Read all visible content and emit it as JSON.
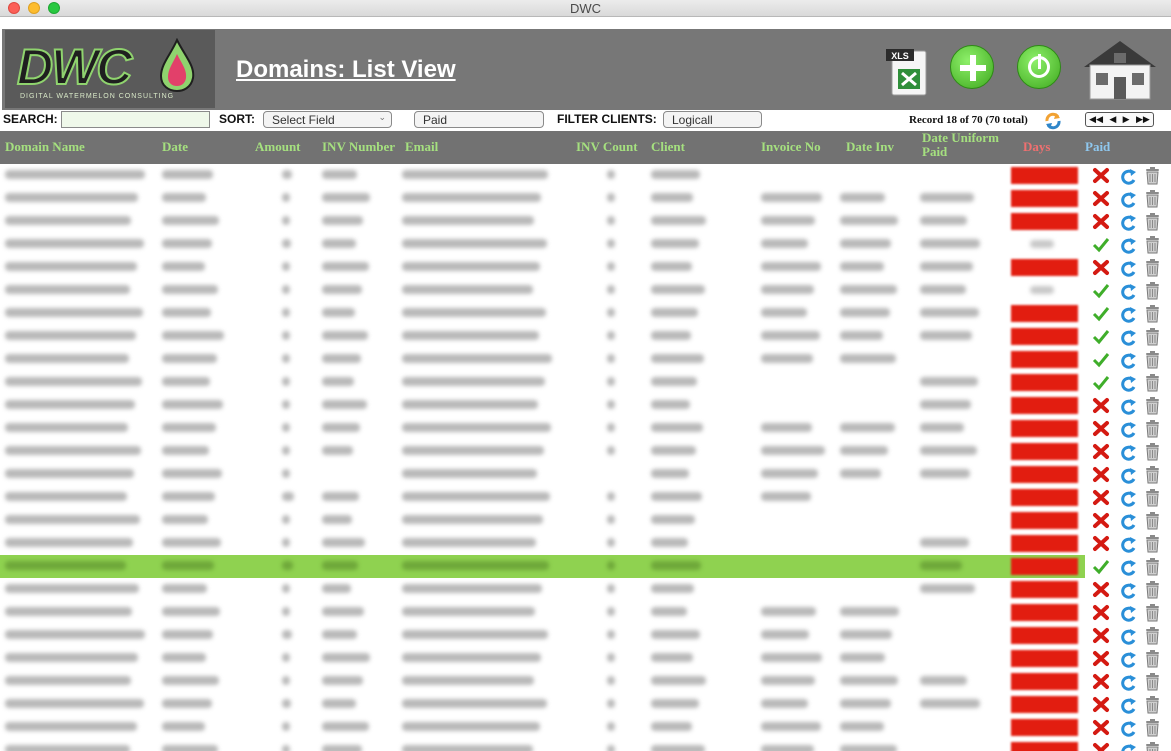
{
  "window": {
    "title": "DWC"
  },
  "header": {
    "logo_text": "DWC",
    "logo_subtext": "DIGITAL WATERMELON CONSULTING",
    "page_title": "Domains: List View",
    "xls_label": "XLS"
  },
  "toolbar": {
    "search_label": "SEARCH:",
    "search_value": "",
    "sort_label": "SORT:",
    "sort_value": "Select Field",
    "paid_filter_value": "Paid",
    "filter_label": "FILTER CLIENTS:",
    "filter_value": "Logicall",
    "record_text": "Record 18 of 70 (70 total)"
  },
  "columns": {
    "domain_name": "Domain Name",
    "date": "Date",
    "amount": "Amount",
    "inv_number": "INV Number",
    "email": "Email",
    "inv_count": "INV Count",
    "client": "Client",
    "invoice_no": "Invoice No",
    "date_inv": "Date Inv",
    "date_uniform_paid_1": "Date Uniform",
    "date_uniform_paid_2": "Paid",
    "days": "Days",
    "paid": "Paid"
  },
  "colors": {
    "header_bg": "#777777",
    "column_text": "#a5e07f",
    "days_red": "#e21d10",
    "selected_row": "#8fd250",
    "paid_blue": "#8fc8ef"
  },
  "rows": [
    {
      "paid": false,
      "days": "red",
      "cols": [
        1,
        1,
        1,
        1,
        1,
        1,
        1,
        0,
        0,
        0
      ]
    },
    {
      "paid": false,
      "days": "red",
      "cols": [
        1,
        1,
        1,
        1,
        1,
        1,
        1,
        1,
        1,
        1
      ]
    },
    {
      "paid": false,
      "days": "red",
      "cols": [
        1,
        1,
        1,
        1,
        1,
        1,
        1,
        1,
        1,
        1
      ]
    },
    {
      "paid": true,
      "days": "blank",
      "cols": [
        1,
        1,
        1,
        1,
        1,
        1,
        1,
        1,
        1,
        1
      ]
    },
    {
      "paid": false,
      "days": "red",
      "cols": [
        1,
        1,
        1,
        1,
        1,
        1,
        1,
        1,
        1,
        1
      ]
    },
    {
      "paid": true,
      "days": "blank",
      "cols": [
        1,
        1,
        1,
        1,
        1,
        1,
        1,
        1,
        1,
        1
      ]
    },
    {
      "paid": true,
      "days": "red",
      "cols": [
        1,
        1,
        1,
        1,
        1,
        1,
        1,
        1,
        1,
        1
      ]
    },
    {
      "paid": true,
      "days": "red",
      "cols": [
        1,
        1,
        1,
        1,
        1,
        1,
        1,
        1,
        1,
        1
      ]
    },
    {
      "paid": true,
      "days": "red",
      "cols": [
        1,
        1,
        1,
        1,
        1,
        1,
        1,
        1,
        1,
        0
      ]
    },
    {
      "paid": true,
      "days": "red",
      "cols": [
        1,
        1,
        1,
        1,
        1,
        1,
        1,
        0,
        0,
        1
      ]
    },
    {
      "paid": false,
      "days": "red",
      "cols": [
        1,
        1,
        1,
        1,
        1,
        1,
        1,
        0,
        0,
        1
      ]
    },
    {
      "paid": false,
      "days": "red",
      "cols": [
        1,
        1,
        1,
        1,
        1,
        1,
        1,
        1,
        1,
        1
      ]
    },
    {
      "paid": false,
      "days": "red",
      "cols": [
        1,
        1,
        1,
        1,
        1,
        1,
        1,
        1,
        1,
        1
      ]
    },
    {
      "paid": false,
      "days": "red",
      "cols": [
        1,
        1,
        1,
        0,
        1,
        0,
        1,
        1,
        1,
        1
      ]
    },
    {
      "paid": false,
      "days": "red",
      "cols": [
        1,
        1,
        1,
        1,
        1,
        1,
        1,
        1,
        0,
        0
      ]
    },
    {
      "paid": false,
      "days": "red",
      "cols": [
        1,
        1,
        1,
        1,
        1,
        1,
        1,
        0,
        0,
        0
      ]
    },
    {
      "paid": false,
      "days": "red",
      "cols": [
        1,
        1,
        1,
        1,
        1,
        1,
        1,
        0,
        0,
        1
      ]
    },
    {
      "paid": true,
      "days": "red",
      "selected": true,
      "cols": [
        1,
        1,
        1,
        1,
        1,
        1,
        1,
        0,
        0,
        1
      ]
    },
    {
      "paid": false,
      "days": "red",
      "cols": [
        1,
        1,
        1,
        1,
        1,
        1,
        1,
        0,
        0,
        1
      ]
    },
    {
      "paid": false,
      "days": "red",
      "cols": [
        1,
        1,
        1,
        1,
        1,
        1,
        1,
        1,
        1,
        0
      ]
    },
    {
      "paid": false,
      "days": "red",
      "cols": [
        1,
        1,
        1,
        1,
        1,
        1,
        1,
        1,
        1,
        0
      ]
    },
    {
      "paid": false,
      "days": "red",
      "cols": [
        1,
        1,
        1,
        1,
        1,
        1,
        1,
        1,
        1,
        0
      ]
    },
    {
      "paid": false,
      "days": "red",
      "cols": [
        1,
        1,
        1,
        1,
        1,
        1,
        1,
        1,
        1,
        1
      ]
    },
    {
      "paid": false,
      "days": "red",
      "cols": [
        1,
        1,
        1,
        1,
        1,
        1,
        1,
        1,
        1,
        1
      ]
    },
    {
      "paid": false,
      "days": "red",
      "cols": [
        1,
        1,
        1,
        1,
        1,
        1,
        1,
        1,
        1,
        0
      ]
    },
    {
      "paid": false,
      "days": "red",
      "cols": [
        1,
        1,
        1,
        1,
        1,
        1,
        1,
        1,
        1,
        0
      ]
    }
  ]
}
